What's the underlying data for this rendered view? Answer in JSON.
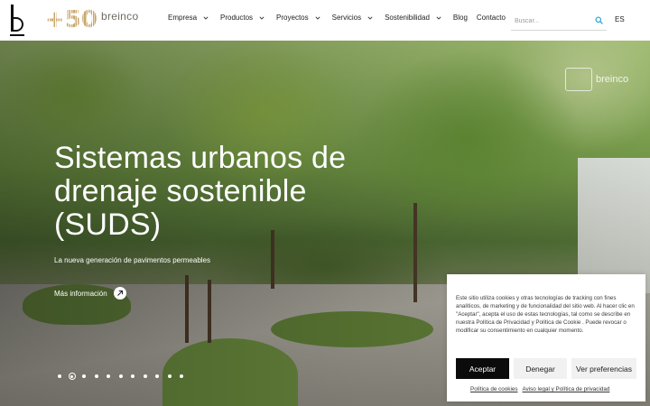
{
  "header": {
    "logo_letter": "b",
    "anniversary_mark": "+50",
    "brand_name": "breinco",
    "nav": [
      {
        "label": "Empresa",
        "has_dropdown": true
      },
      {
        "label": "Productos",
        "has_dropdown": true
      },
      {
        "label": "Proyectos",
        "has_dropdown": true
      },
      {
        "label": "Servicios",
        "has_dropdown": true
      },
      {
        "label": "Sostenibilidad",
        "has_dropdown": true
      },
      {
        "label": "Blog",
        "has_dropdown": false
      },
      {
        "label": "Contacto",
        "has_dropdown": false
      }
    ],
    "search_placeholder": "Buscar...",
    "search_value": "",
    "language": "ES"
  },
  "hero": {
    "watermark_text": "breinco",
    "title": "Sistemas urbanos de drenaje sostenible (SUDS)",
    "subtitle": "La nueva generación de pavimentos permeables",
    "cta_label": "Más información",
    "slide_count": 11,
    "active_slide": 2
  },
  "cookie_banner": {
    "text": "Este sitio utiliza cookies y otras tecnologías de tracking con fines analíticos, de marketing y de funcionalidad del sitio web. Al hacer clic en \"Aceptar\", acepta el uso de estas tecnologías, tal como se describe en nuestra Política de Privacidad y Política de Cookie . Puede revocar o modificar su consentimiento en cualquier momento.",
    "accept_label": "Aceptar",
    "deny_label": "Denegar",
    "preferences_label": "Ver preferencias",
    "links": [
      "Política de cookies",
      "Aviso legal y Política de privacidad"
    ]
  },
  "colors": {
    "accent_gold": "#c9a76c",
    "button_dark": "#0b0b0b",
    "search_icon": "#2aa3d9"
  },
  "icons": {
    "search": "search-icon",
    "dropdown": "chevron-down-icon",
    "cta": "arrow-up-right-icon"
  }
}
